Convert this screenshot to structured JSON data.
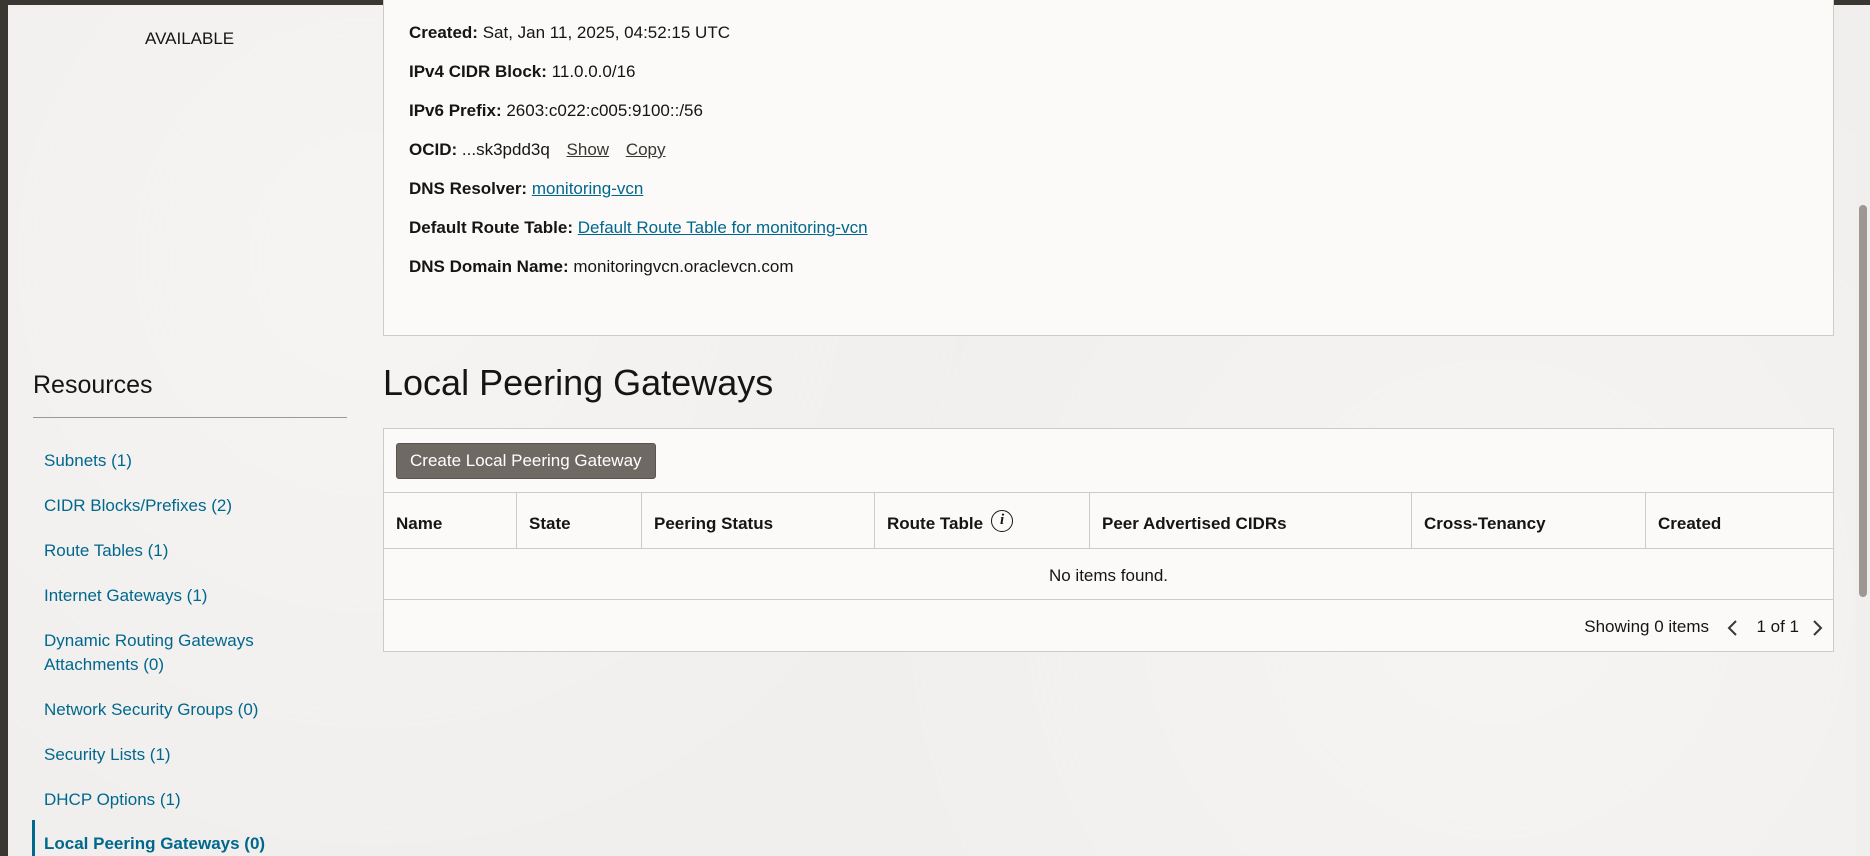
{
  "status": "AVAILABLE",
  "details": {
    "created_label": "Created:",
    "created_value": "Sat, Jan 11, 2025, 04:52:15 UTC",
    "ipv4_label": "IPv4 CIDR Block:",
    "ipv4_value": "11.0.0.0/16",
    "ipv6_label": "IPv6 Prefix:",
    "ipv6_value": "2603:c022:c005:9100::/56",
    "ocid_label": "OCID:",
    "ocid_value": "...sk3pdd3q",
    "ocid_show": "Show",
    "ocid_copy": "Copy",
    "dns_resolver_label": "DNS Resolver:",
    "dns_resolver_value": "monitoring-vcn",
    "route_table_label": "Default Route Table:",
    "route_table_value": "Default Route Table for monitoring-vcn",
    "dns_domain_label": "DNS Domain Name:",
    "dns_domain_value": "monitoringvcn.oraclevcn.com"
  },
  "resources": {
    "heading": "Resources",
    "items": [
      {
        "label": "Subnets (1)"
      },
      {
        "label": "CIDR Blocks/Prefixes (2)"
      },
      {
        "label": "Route Tables (1)"
      },
      {
        "label": "Internet Gateways (1)"
      },
      {
        "label": "Dynamic Routing Gateways"
      },
      {
        "label": "Attachments (0)"
      },
      {
        "label": "Network Security Groups (0)"
      },
      {
        "label": "Security Lists (1)"
      },
      {
        "label": "DHCP Options (1)"
      },
      {
        "label": "Local Peering Gateways (0)"
      }
    ]
  },
  "section": {
    "title": "Local Peering Gateways",
    "create_button": "Create Local Peering Gateway"
  },
  "table": {
    "columns": [
      "Name",
      "State",
      "Peering Status",
      "Route Table",
      "Peer Advertised CIDRs",
      "Cross-Tenancy",
      "Created"
    ],
    "empty_message": "No items found.",
    "showing": "Showing 0 items",
    "page": "1 of 1"
  },
  "icons": {
    "info": "info-icon",
    "prev": "chevron-left-icon",
    "next": "chevron-right-icon"
  },
  "colors": {
    "link": "#00688c",
    "button": "#6f6964",
    "background": "#f1efed"
  }
}
